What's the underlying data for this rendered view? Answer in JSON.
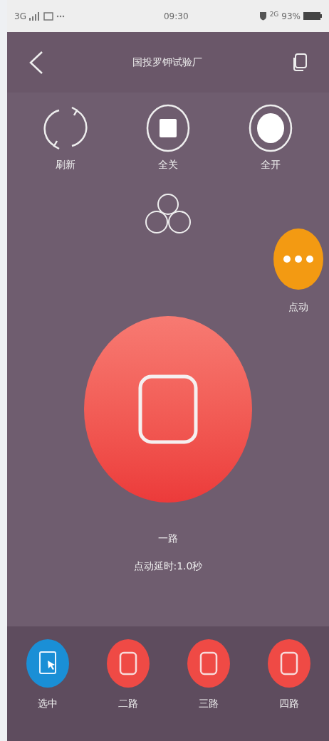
{
  "status_bar": {
    "signal": "3G",
    "time": "09:30",
    "network": "2G",
    "battery": "93%"
  },
  "nav": {
    "title": "国投罗钾试验厂"
  },
  "actions": [
    {
      "kind": "refresh",
      "label": "刷新"
    },
    {
      "kind": "all_off",
      "label": "全关"
    },
    {
      "kind": "all_on",
      "label": "全开"
    }
  ],
  "jog_button": {
    "label": "点动"
  },
  "main_switch": {
    "name": "一路",
    "delay": "点动延时:1.0秒"
  },
  "bottom_bar": [
    {
      "kind": "select",
      "label": "选中"
    },
    {
      "kind": "switch",
      "label": "二路"
    },
    {
      "kind": "switch",
      "label": "三路"
    },
    {
      "kind": "switch",
      "label": "四路"
    }
  ]
}
